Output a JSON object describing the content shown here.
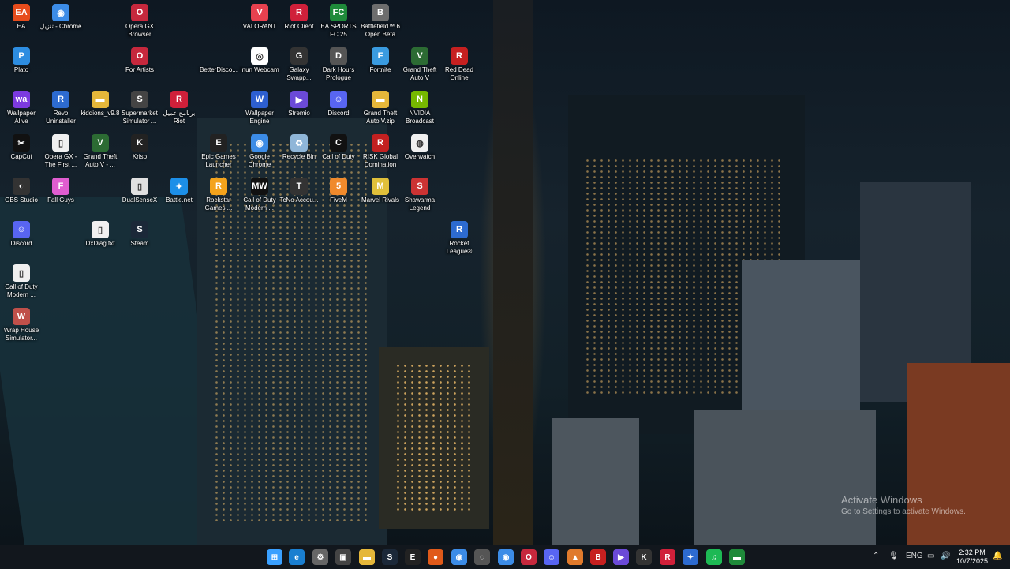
{
  "desktop": {
    "icons": [
      {
        "label": "EA",
        "glyph": "EA",
        "color": "#e74c1c",
        "id": "ea"
      },
      {
        "label": "تنزيل - Chrome",
        "glyph": "◉",
        "color": "#3c8ce7",
        "id": "chrome-download"
      },
      {
        "label": "Opera GX Browser",
        "glyph": "O",
        "color": "#c6283d",
        "id": "opera-gx"
      },
      {
        "label": "VALORANT",
        "glyph": "V",
        "color": "#e8414f",
        "id": "valorant"
      },
      {
        "label": "Riot Client",
        "glyph": "R",
        "color": "#d0203a",
        "id": "riot-client"
      },
      {
        "label": "EA SPORTS FC 25",
        "glyph": "FC",
        "color": "#1f8a3a",
        "id": "fc25"
      },
      {
        "label": "Battlefield™ 6 Open Beta",
        "glyph": "B",
        "color": "#6d6d6d",
        "id": "battlefield"
      },
      {
        "label": "Plato",
        "glyph": "P",
        "color": "#2d8de1",
        "id": "plato"
      },
      {
        "label": "For Artists",
        "glyph": "O",
        "color": "#c6283d",
        "id": "for-artists"
      },
      {
        "label": "BetterDisco...",
        "glyph": "",
        "color": "transparent",
        "id": "betterdiscord"
      },
      {
        "label": "Inun Webcam",
        "glyph": "◎",
        "color": "#ffffff",
        "id": "webcam"
      },
      {
        "label": "Galaxy Swapp...",
        "glyph": "G",
        "color": "#333",
        "id": "galaxy-swapper"
      },
      {
        "label": "Dark Hours Prologue",
        "glyph": "D",
        "color": "#555",
        "id": "dark-hours"
      },
      {
        "label": "Fortnite",
        "glyph": "F",
        "color": "#3a9be0",
        "id": "fortnite"
      },
      {
        "label": "Grand Theft Auto V",
        "glyph": "V",
        "color": "#2c6b33",
        "id": "gta5"
      },
      {
        "label": "Red Dead Online",
        "glyph": "R",
        "color": "#c62020",
        "id": "rdo"
      },
      {
        "label": "Wallpaper Alive",
        "glyph": "wa",
        "color": "#7c3ae0",
        "id": "wallpaper-alive"
      },
      {
        "label": "Revo Uninstaller",
        "glyph": "R",
        "color": "#2d6bd0",
        "id": "revo"
      },
      {
        "label": "kiddions_v9.8",
        "glyph": "▬",
        "color": "#e5b73a",
        "id": "kiddions"
      },
      {
        "label": "Supermarket Simulator ...",
        "glyph": "S",
        "color": "#444",
        "id": "supermarket"
      },
      {
        "label": "برنامج عميل Riot",
        "glyph": "R",
        "color": "#d0203a",
        "id": "riot-ar"
      },
      {
        "label": "Wallpaper Engine",
        "glyph": "W",
        "color": "#2d5fd0",
        "id": "wallpaper-engine"
      },
      {
        "label": "Stremio",
        "glyph": "▶",
        "color": "#6b4ad8",
        "id": "stremio"
      },
      {
        "label": "Discord",
        "glyph": "☺",
        "color": "#5865f2",
        "id": "discord-1"
      },
      {
        "label": "Grand Theft Auto V.zip",
        "glyph": "▬",
        "color": "#e5b73a",
        "id": "gta-zip"
      },
      {
        "label": "NVIDIA Broadcast",
        "glyph": "N",
        "color": "#76b900",
        "id": "nvidia"
      },
      {
        "label": "CapCut",
        "glyph": "✂",
        "color": "#111",
        "id": "capcut"
      },
      {
        "label": "Opera GX - The First ...",
        "glyph": "▯",
        "color": "#f0f0f0",
        "id": "opera-doc"
      },
      {
        "label": "Grand Theft Auto V - ...",
        "glyph": "V",
        "color": "#2c6b33",
        "id": "gta5-b"
      },
      {
        "label": "Krisp",
        "glyph": "K",
        "color": "#222",
        "id": "krisp"
      },
      {
        "label": "Epic Games Launcher",
        "glyph": "E",
        "color": "#222",
        "id": "epic"
      },
      {
        "label": "Google Chrome",
        "glyph": "◉",
        "color": "#3c8ce7",
        "id": "chrome"
      },
      {
        "label": "Recycle Bin",
        "glyph": "♻",
        "color": "#8fb6d8",
        "id": "recycle-bin"
      },
      {
        "label": "Call of Duty",
        "glyph": "C",
        "color": "#111",
        "id": "cod"
      },
      {
        "label": "RISK Global Domination",
        "glyph": "R",
        "color": "#c32020",
        "id": "risk"
      },
      {
        "label": "Overwatch",
        "glyph": "◍",
        "color": "#f0f0f0",
        "id": "overwatch"
      },
      {
        "label": "OBS Studio",
        "glyph": "◐",
        "color": "#333",
        "id": "obs"
      },
      {
        "label": "Fall Guys",
        "glyph": "F",
        "color": "#e05dd0",
        "id": "fall-guys"
      },
      {
        "label": "DualSenseX",
        "glyph": "▯",
        "color": "#e0e0e0",
        "id": "dualsensex"
      },
      {
        "label": "Battle.net",
        "glyph": "✦",
        "color": "#1c8fe8",
        "id": "battlenet"
      },
      {
        "label": "Rockstar Games ...",
        "glyph": "R",
        "color": "#f4a31c",
        "id": "rockstar"
      },
      {
        "label": "Call of Duty Modern ...",
        "glyph": "MW",
        "color": "#111",
        "id": "cod-mw"
      },
      {
        "label": "TcNo Accou...",
        "glyph": "T",
        "color": "#333",
        "id": "tcno"
      },
      {
        "label": "FiveM",
        "glyph": "5",
        "color": "#f08a2c",
        "id": "fivem"
      },
      {
        "label": "Marvel Rivals",
        "glyph": "M",
        "color": "#e0c03a",
        "id": "marvel"
      },
      {
        "label": "Shawarma Legend",
        "glyph": "S",
        "color": "#c33",
        "id": "shawarma"
      },
      {
        "label": "Discord",
        "glyph": "☺",
        "color": "#5865f2",
        "id": "discord-2"
      },
      {
        "label": "DxDiag.txt",
        "glyph": "▯",
        "color": "#f0f0f0",
        "id": "dxdiag"
      },
      {
        "label": "Steam",
        "glyph": "S",
        "color": "#1b2838",
        "id": "steam"
      },
      {
        "label": "Rocket League®",
        "glyph": "R",
        "color": "#2d6bd0",
        "id": "rocket-league"
      },
      {
        "label": "Call of Duty Modern ...",
        "glyph": "▯",
        "color": "#f0f0f0",
        "id": "cod-modern-doc"
      },
      {
        "label": "Wrap House Simulator...",
        "glyph": "W",
        "color": "#c0504a",
        "id": "wrap-house"
      }
    ]
  },
  "watermark": {
    "title": "Activate Windows",
    "subtitle": "Go to Settings to activate Windows."
  },
  "taskbar": {
    "apps": [
      {
        "name": "start",
        "glyph": "⊞",
        "color": "#3aa0ff"
      },
      {
        "name": "edge",
        "glyph": "e",
        "color": "#1a7fd0"
      },
      {
        "name": "settings",
        "glyph": "⚙",
        "color": "#666"
      },
      {
        "name": "store",
        "glyph": "▣",
        "color": "#444"
      },
      {
        "name": "file-explorer",
        "glyph": "▬",
        "color": "#e5b73a"
      },
      {
        "name": "steam",
        "glyph": "S",
        "color": "#1b2838"
      },
      {
        "name": "epic",
        "glyph": "E",
        "color": "#222"
      },
      {
        "name": "app-orange",
        "glyph": "●",
        "color": "#e05a1a"
      },
      {
        "name": "chrome",
        "glyph": "◉",
        "color": "#3c8ce7"
      },
      {
        "name": "app-grey",
        "glyph": "◌",
        "color": "#555"
      },
      {
        "name": "chrome-2",
        "glyph": "◉",
        "color": "#3c8ce7"
      },
      {
        "name": "opera",
        "glyph": "O",
        "color": "#c6283d"
      },
      {
        "name": "discord",
        "glyph": "☺",
        "color": "#5865f2"
      },
      {
        "name": "app-orange-2",
        "glyph": "▲",
        "color": "#e07a2c"
      },
      {
        "name": "app-red",
        "glyph": "B",
        "color": "#c62020"
      },
      {
        "name": "stremio",
        "glyph": "▶",
        "color": "#6b4ad8"
      },
      {
        "name": "app-k",
        "glyph": "K",
        "color": "#333"
      },
      {
        "name": "riot",
        "glyph": "R",
        "color": "#d0203a"
      },
      {
        "name": "app-blue",
        "glyph": "✦",
        "color": "#2d6bd0"
      },
      {
        "name": "spotify",
        "glyph": "♫",
        "color": "#1db954"
      },
      {
        "name": "app-green",
        "glyph": "▬",
        "color": "#1f8a3a"
      }
    ],
    "tray": {
      "lang": "ENG",
      "time": "2:32 PM",
      "date": "10/7/2025"
    }
  }
}
